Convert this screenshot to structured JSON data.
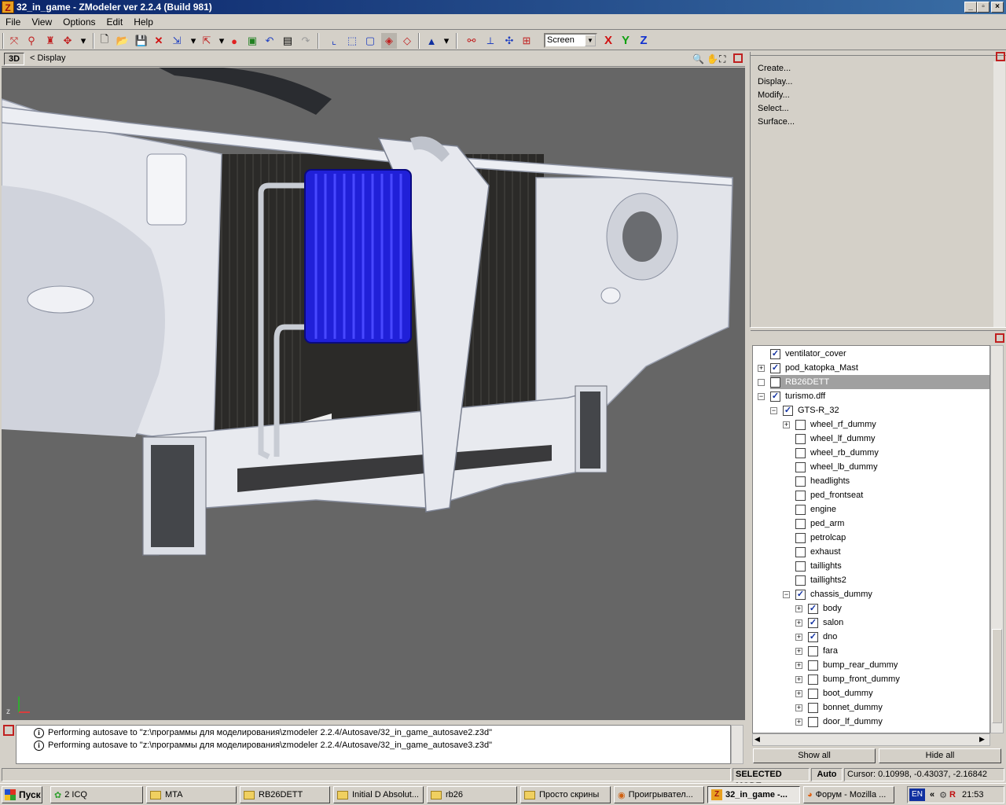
{
  "window": {
    "app_icon_letter": "Z",
    "title": "32_in_game - ZModeler ver 2.2.4 (Build 981)",
    "controls": [
      "_",
      "▫",
      "×"
    ]
  },
  "menu": [
    "File",
    "View",
    "Options",
    "Edit",
    "Help"
  ],
  "toolbar": {
    "view_mode_select": "Screen",
    "axis_x": "X",
    "axis_y": "Y",
    "axis_z": "Z"
  },
  "viewport": {
    "view_button": "3D",
    "display_label": "<  Display",
    "axis_gizmo_label": "z"
  },
  "command_panel": {
    "items": [
      "Create...",
      "Display...",
      "Modify...",
      "Select...",
      "Surface..."
    ]
  },
  "hierarchy": {
    "rows": [
      {
        "label": "ventilator_cover",
        "checked": true
      },
      {
        "label": "pod_katopka_Mast",
        "checked": true
      },
      {
        "label": "RB26DETT",
        "checked": false
      },
      {
        "label": "turismo.dff",
        "checked": true
      },
      {
        "label": "GTS-R_32",
        "checked": true
      },
      {
        "label": "wheel_rf_dummy",
        "checked": false
      },
      {
        "label": "wheel_lf_dummy",
        "checked": false
      },
      {
        "label": "wheel_rb_dummy",
        "checked": false
      },
      {
        "label": "wheel_lb_dummy",
        "checked": false
      },
      {
        "label": "headlights",
        "checked": false
      },
      {
        "label": "ped_frontseat",
        "checked": false
      },
      {
        "label": "engine",
        "checked": false
      },
      {
        "label": "ped_arm",
        "checked": false
      },
      {
        "label": "petrolcap",
        "checked": false
      },
      {
        "label": "exhaust",
        "checked": false
      },
      {
        "label": "taillights",
        "checked": false
      },
      {
        "label": "taillights2",
        "checked": false
      },
      {
        "label": "chassis_dummy",
        "checked": true
      },
      {
        "label": "body",
        "checked": true
      },
      {
        "label": "salon",
        "checked": true
      },
      {
        "label": "dno",
        "checked": true
      },
      {
        "label": "fara",
        "checked": false
      },
      {
        "label": "bump_rear_dummy",
        "checked": false
      },
      {
        "label": "bump_front_dummy",
        "checked": false
      },
      {
        "label": "boot_dummy",
        "checked": false
      },
      {
        "label": "bonnet_dummy",
        "checked": false
      },
      {
        "label": "door_lf_dummy",
        "checked": false
      }
    ],
    "show_all": "Show all",
    "hide_all": "Hide all"
  },
  "log": [
    "Performing autosave to \"z:\\программы для моделирования\\zmodeler 2.2.4/Autosave/32_in_game_autosave2.z3d\"",
    "Performing autosave to \"z:\\программы для моделирования\\zmodeler 2.2.4/Autosave/32_in_game_autosave3.z3d\""
  ],
  "status": {
    "mode": "SELECTED MODE",
    "auto": "Auto",
    "cursor": "Cursor: 0.10998, -0.43037, -2.16842"
  },
  "taskbar": {
    "start": "Пуск",
    "tasks": [
      "2 ICQ",
      "MTA",
      "RB26DETT",
      "Initial D Absolut...",
      "rb26",
      "Просто скрины",
      "Проигрывател...",
      "32_in_game -...",
      "Форум - Mozilla ..."
    ],
    "lang": "EN",
    "clock": "21:53"
  },
  "colors": {
    "title_start": "#0a246a",
    "title_end": "#3a6ea5",
    "viewport_bg": "#666666",
    "cooler_blue": "#2020d8",
    "chassis_white": "#e6e8ee"
  }
}
